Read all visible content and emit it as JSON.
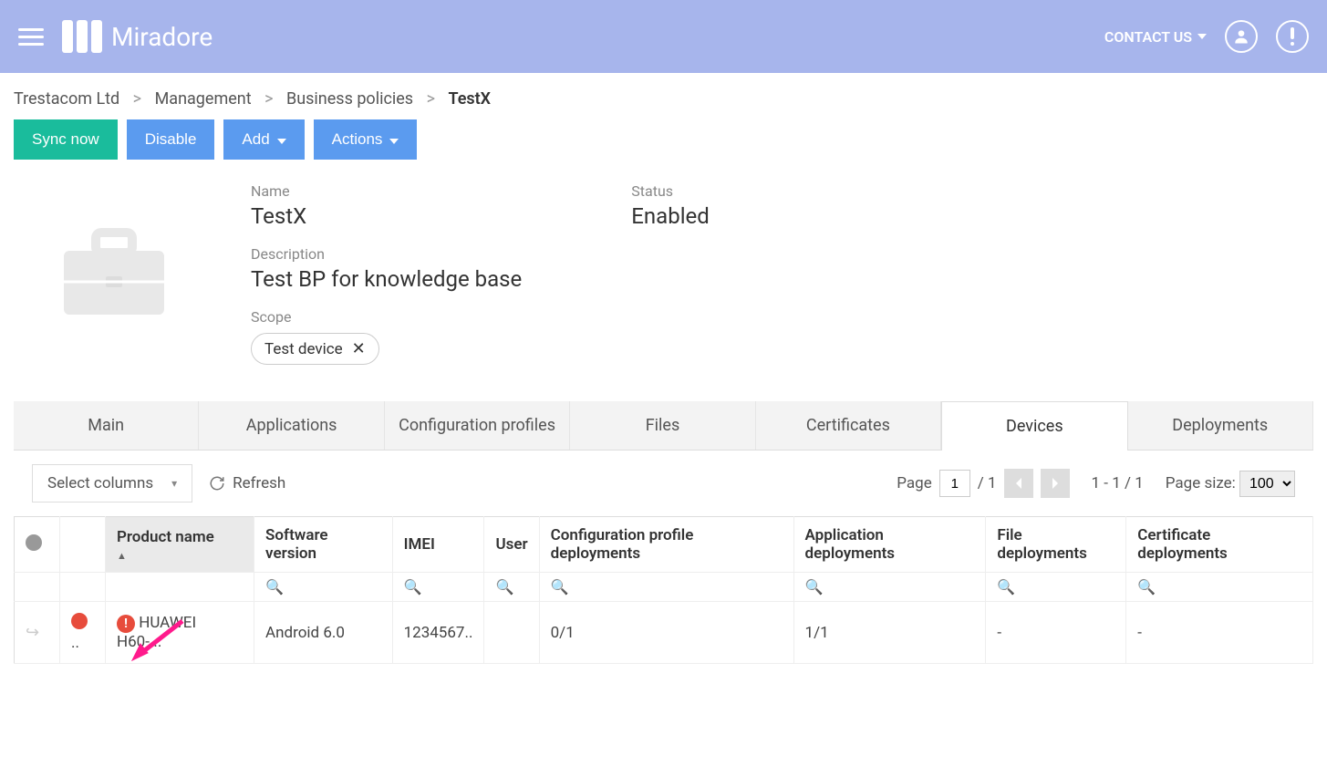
{
  "header": {
    "brand": "Miradore",
    "contact": "CONTACT US"
  },
  "breadcrumb": {
    "org": "Trestacom Ltd",
    "parent1": "Management",
    "parent2": "Business policies",
    "current": "TestX"
  },
  "actions": {
    "sync": "Sync now",
    "disable": "Disable",
    "add": "Add",
    "actions": "Actions"
  },
  "details": {
    "name_label": "Name",
    "name_value": "TestX",
    "description_label": "Description",
    "description_value": "Test BP for knowledge base",
    "scope_label": "Scope",
    "scope_chip": "Test device",
    "status_label": "Status",
    "status_value": "Enabled"
  },
  "tabs": {
    "main": "Main",
    "applications": "Applications",
    "config": "Configuration profiles",
    "files": "Files",
    "certificates": "Certificates",
    "devices": "Devices",
    "deployments": "Deployments"
  },
  "toolbar": {
    "select_columns": "Select columns",
    "refresh": "Refresh",
    "page_label": "Page",
    "page_value": "1",
    "page_total": "/ 1",
    "range": "1 - 1 / 1",
    "page_size_label": "Page size:",
    "page_size_value": "100"
  },
  "table": {
    "headers": {
      "product": "Product name",
      "software": "Software version",
      "imei": "IMEI",
      "user": "User",
      "config_deploy": "Configuration profile deployments",
      "app_deploy": "Application deployments",
      "file_deploy": "File deployments",
      "cert_deploy": "Certificate deployments"
    },
    "row": {
      "status_text": "..",
      "product": "HUAWEI H60-...",
      "software": "Android 6.0",
      "imei": "1234567..",
      "user": "",
      "config_deploy": "0/1",
      "app_deploy": "1/1",
      "file_deploy": "-",
      "cert_deploy": "-"
    }
  }
}
